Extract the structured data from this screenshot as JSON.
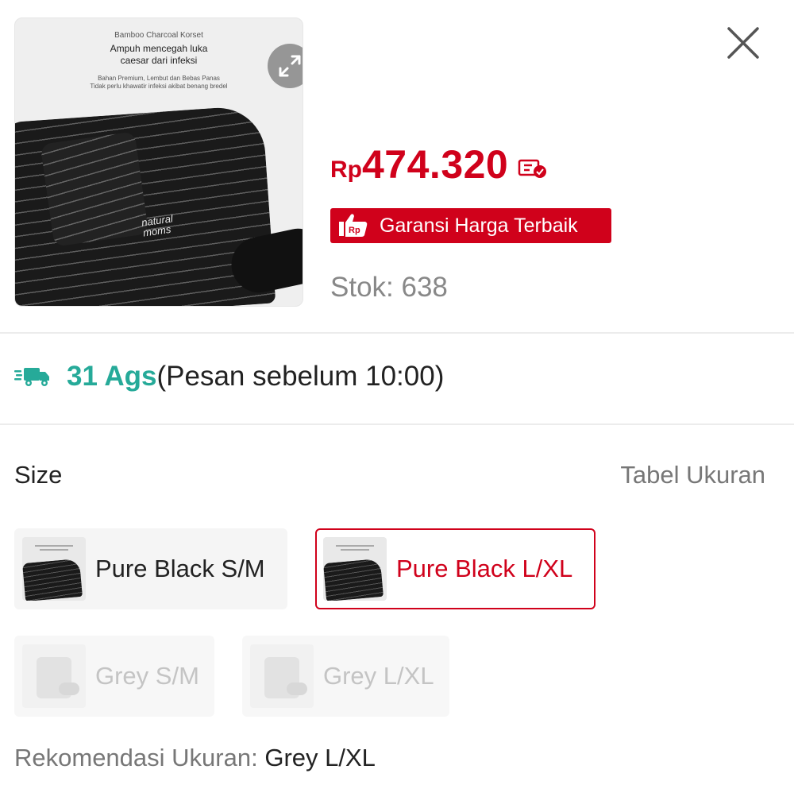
{
  "product": {
    "image_text": {
      "line1": "Bamboo Charcoal Korset",
      "line2": "Ampuh mencegah luka",
      "line3": "caesar dari infeksi",
      "line4": "Bahan Premium, Lembut dan Bebas Panas",
      "line5": "Tidak perlu khawatir infeksi akibat benang bredel",
      "brand_line1": "natural",
      "brand_line2": "moms"
    },
    "price_currency": "Rp",
    "price_amount": "474.320",
    "guarantee_label": "Garansi Harga Terbaik",
    "stock_label": "Stok: 638"
  },
  "delivery": {
    "date": "31 Ags",
    "note": "(Pesan sebelum 10:00)"
  },
  "size": {
    "title": "Size",
    "table_link": "Tabel Ukuran",
    "variants": [
      {
        "label": "Pure Black S/M",
        "state": "normal"
      },
      {
        "label": "Pure Black L/XL",
        "state": "selected"
      },
      {
        "label": "Grey S/M",
        "state": "disabled"
      },
      {
        "label": "Grey L/XL",
        "state": "disabled"
      }
    ],
    "recommendation_label": "Rekomendasi Ukuran: ",
    "recommendation_value": "Grey L/XL"
  },
  "colors": {
    "brand_red": "#d0011b",
    "delivery_teal": "#26aa99"
  },
  "icons": {
    "expand": "expand-icon",
    "close": "close-icon",
    "price_tag": "price-tag-check-icon",
    "guarantee": "thumbs-up-rp-icon",
    "truck": "fast-delivery-truck-icon"
  }
}
